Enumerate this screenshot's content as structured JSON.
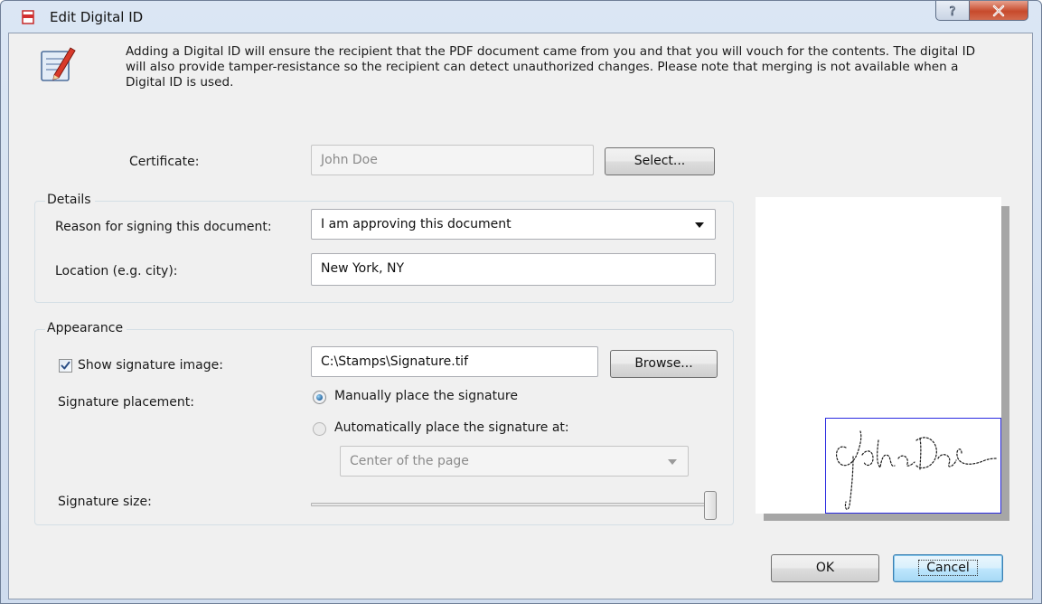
{
  "window": {
    "title": "Edit Digital ID",
    "help_icon": "question-icon",
    "close_icon": "close-icon"
  },
  "intro": {
    "icon": "edit-document-pen-icon",
    "text": "Adding a Digital ID will ensure the recipient that the PDF document came from you and that you will vouch for the contents. The digital ID will also provide tamper-resistance so the recipient can detect unauthorized changes. Please note that merging is not available when a Digital ID is used."
  },
  "certificate": {
    "label": "Certificate:",
    "value": "John Doe",
    "select_button": "Select..."
  },
  "details": {
    "group_title": "Details",
    "reason_label": "Reason for signing this document:",
    "reason_value": "I am approving this document",
    "location_label": "Location (e.g. city):",
    "location_value": "New York, NY"
  },
  "appearance": {
    "group_title": "Appearance",
    "show_image_label": "Show signature image:",
    "show_image_checked": true,
    "image_path": "C:\\Stamps\\Signature.tif",
    "browse_button": "Browse...",
    "placement_label": "Signature placement:",
    "manual_option": "Manually place the signature",
    "auto_option": "Automatically place the signature at:",
    "selected_option": "manual",
    "auto_position_value": "Center of the page",
    "size_label": "Signature size:",
    "size_level": 1.0
  },
  "preview": {
    "signature_text": "John Doe"
  },
  "buttons": {
    "ok": "OK",
    "cancel": "Cancel"
  },
  "colors": {
    "signature_border": "#2a2ae0",
    "default_button_border": "#3c7fb1"
  }
}
